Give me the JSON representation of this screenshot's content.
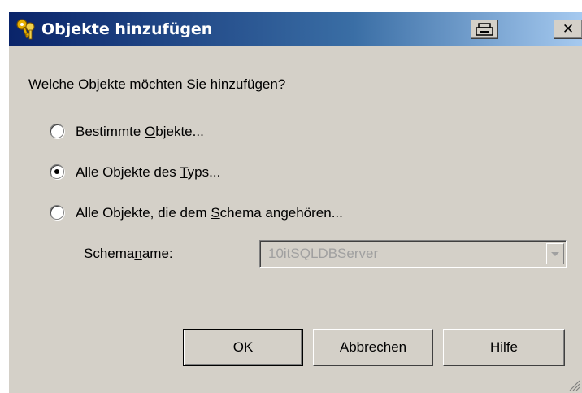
{
  "window": {
    "title": "Objekte hinzufügen"
  },
  "prompt": "Welche Objekte möchten Sie hinzufügen?",
  "options": [
    {
      "pre": "Bestimmte ",
      "accel": "O",
      "post": "bjekte...",
      "selected": false
    },
    {
      "pre": "Alle Objekte des ",
      "accel": "T",
      "post": "yps...",
      "selected": true
    },
    {
      "pre": "Alle Objekte, die dem ",
      "accel": "S",
      "post": "chema angehören...",
      "selected": false
    }
  ],
  "schema": {
    "label_pre": "Schema",
    "label_accel": "n",
    "label_post": "ame:",
    "value": "10itSQLDBServer",
    "enabled": false
  },
  "buttons": {
    "ok": "OK",
    "cancel": "Abbrechen",
    "help": "Hilfe"
  },
  "icons": {
    "title": "keys-icon",
    "print": "printer-icon",
    "close": "close-icon",
    "dropdown": "chevron-down-icon",
    "grip": "resize-grip-icon"
  },
  "colors": {
    "titlebar_start": "#0a246a",
    "titlebar_end": "#a6caf0",
    "face": "#d4d0c8",
    "disabled_text": "#a0a0a0"
  }
}
